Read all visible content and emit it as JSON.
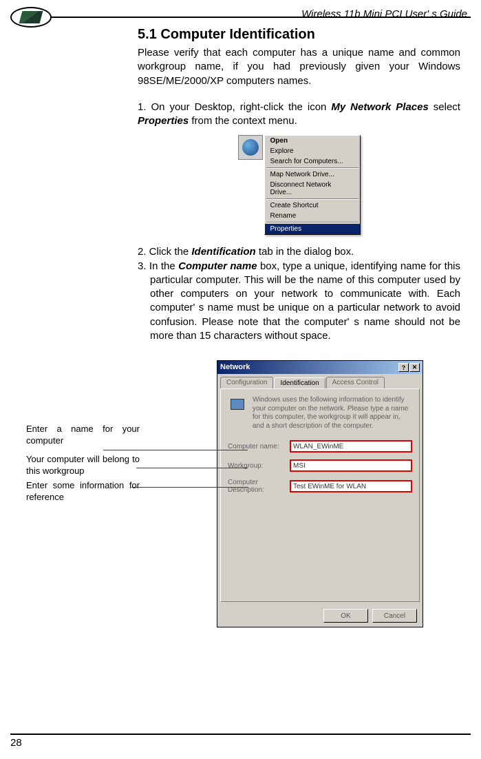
{
  "header": {
    "title": "Wireless 11b Mini PCI  User' s Guide"
  },
  "section": {
    "heading": "5.1 Computer Identification",
    "intro": "Please verify that each computer has a unique name and common workgroup name, if you had previously given your Windows 98SE/ME/2000/XP computers names.",
    "step1_part1": "1. On your Desktop, right-click the icon ",
    "step1_bold1": "My Network Places",
    "step1_part2": " select ",
    "step1_bold2": "Properties",
    "step1_part3": " from the context menu.",
    "step2_part1": "2. Click the ",
    "step2_bold": "Identification",
    "step2_part2": " tab in the dialog box.",
    "step3_part1": "3. In the ",
    "step3_bold": "Computer name",
    "step3_part2": " box, type a unique, identifying name for this particular computer. This will be the name of this computer used by other computers on your network to communicate with. Each computer' s name must be unique on a particular network to avoid confusion. Please note that the computer' s name should not be more than 15 characters without space."
  },
  "context_menu": {
    "items": [
      "Open",
      "Explore",
      "Search for Computers...",
      "Map Network Drive...",
      "Disconnect Network Drive...",
      "Create Shortcut",
      "Rename",
      "Properties"
    ]
  },
  "side_labels": {
    "label1": "Enter a name for your computer",
    "label2": "Your computer will belong to this workgroup",
    "label3": "Enter some information for reference"
  },
  "dialog": {
    "title": "Network",
    "tabs": [
      "Configuration",
      "Identification",
      "Access Control"
    ],
    "info_text": "Windows uses the following information to identify your computer on the network. Please type a name for this computer, the workgroup it will appear in, and a short description of the computer.",
    "fields": {
      "computer_name_label": "Computer name:",
      "computer_name_value": "WLAN_EWinME",
      "workgroup_label": "Workgroup:",
      "workgroup_value": "MSI",
      "description_label": "Computer Description:",
      "description_value": "Test EWinME for WLAN"
    },
    "buttons": {
      "ok": "OK",
      "cancel": "Cancel"
    }
  },
  "footer": {
    "page": "28"
  }
}
